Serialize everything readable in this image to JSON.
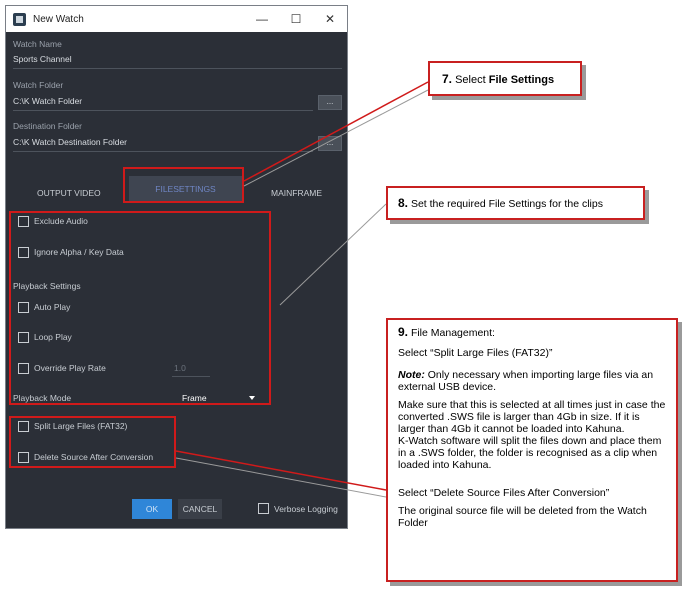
{
  "window": {
    "title": "New Watch",
    "controls": {
      "minimize": "—",
      "maximize": "☐",
      "close": "✕"
    }
  },
  "fields": {
    "watch_name": {
      "label": "Watch Name",
      "value": "Sports Channel"
    },
    "watch_folder": {
      "label": "Watch Folder",
      "value": "C:\\K Watch Folder",
      "browse": "..."
    },
    "destination_folder": {
      "label": "Destination Folder",
      "value": "C:\\K Watch Destination Folder",
      "browse": "..."
    }
  },
  "tabs": [
    {
      "label": "OUTPUT VIDEO"
    },
    {
      "label": "FILESETTINGS",
      "active": true
    },
    {
      "label": "MAINFRAME"
    }
  ],
  "file_settings": {
    "exclude_audio": "Exclude Audio",
    "ignore_alpha": "Ignore Alpha / Key Data",
    "playback_settings": "Playback Settings",
    "auto_play": "Auto Play",
    "loop_play": "Loop Play",
    "override_play_rate": "Override Play Rate",
    "play_rate_value": "1.0",
    "playback_mode_label": "Playback Mode",
    "playback_mode_value": "Frame"
  },
  "file_management": {
    "split_large_files": "Split Large Files (FAT32)",
    "delete_source": "Delete Source After Conversion"
  },
  "footer": {
    "ok": "OK",
    "cancel": "CANCEL",
    "verbose_logging": "Verbose Logging"
  },
  "annotations": {
    "step7": {
      "num": "7.",
      "text_pre": "Select ",
      "text_bold": "File Settings"
    },
    "step8": {
      "num": "8.",
      "text": "Set the required File Settings for the clips"
    },
    "step9": {
      "num": "9.",
      "heading": "File Management:",
      "line1": "Select “Split Large Files (FAT32)”",
      "note_label": "Note:",
      "note_text": "Only necessary when importing large files via an external USB device.",
      "para1": "Make sure that this is selected at all times just in case the converted .SWS file is larger than 4Gb in size. If it is larger than 4Gb it cannot be loaded into Kahuna.",
      "para2": "K-Watch software will split the files down and place them in a .SWS folder, the folder is recognised as a clip when loaded into Kahuna.",
      "line2": "Select “Delete Source Files After Conversion”",
      "para3": "The original source file will be deleted from the Watch Folder"
    }
  },
  "colors": {
    "window_bg": "#2b2f37",
    "accent_blue": "#2f86d8",
    "annotation_red": "#d01a1a"
  }
}
